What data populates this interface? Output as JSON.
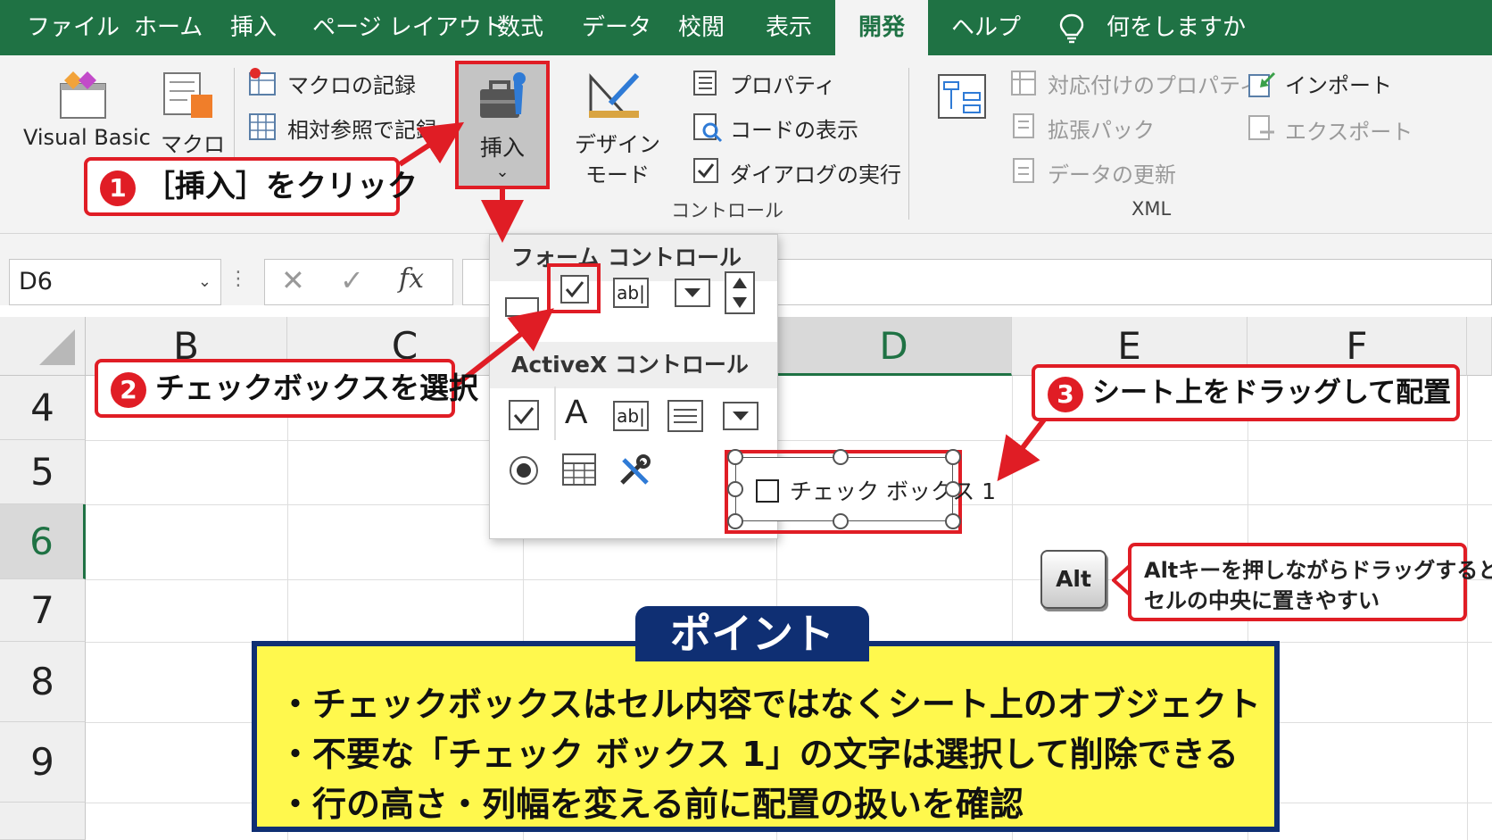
{
  "menu": {
    "tabs": [
      "ファイル",
      "ホーム",
      "挿入",
      "ページ レイアウト",
      "数式",
      "データ",
      "校閲",
      "表示",
      "開発",
      "ヘルプ"
    ],
    "active_tab": "開発",
    "tell_me": "何をしますか"
  },
  "ribbon": {
    "visual_basic": "Visual Basic",
    "macro": "マクロ",
    "record_macro": "マクロの記録",
    "relative_ref": "相対参照で記録",
    "insert": "挿入",
    "design_mode_1": "デザイン",
    "design_mode_2": "モード",
    "properties": "プロパティ",
    "view_code": "コードの表示",
    "run_dialog": "ダイアログの実行",
    "controls_group": "コントロール",
    "map_properties": "対応付けのプロパティ",
    "expansion_pack": "拡張パック",
    "refresh_data": "データの更新",
    "import": "インポート",
    "export": "エクスポート",
    "xml_group": "XML"
  },
  "formula_bar": {
    "name_box": "D6",
    "fx": "fx"
  },
  "grid": {
    "columns": [
      "B",
      "C",
      "D",
      "E",
      "F"
    ],
    "rows": [
      "4",
      "5",
      "6",
      "7",
      "8",
      "9"
    ],
    "selected_column": "D",
    "selected_row": "6"
  },
  "dropdown": {
    "form_controls": "フォーム コントロール",
    "activex_controls": "ActiveX コントロール",
    "text_icon_label": "ab|",
    "label_a": "A"
  },
  "checkbox_control": {
    "label": "チェック ボックス 1"
  },
  "callouts": {
    "step1": {
      "num": "1",
      "text": "［挿入］をクリック"
    },
    "step2": {
      "num": "2",
      "text": "チェックボックスを選択"
    },
    "step3": {
      "num": "3",
      "text": "シート上をドラッグして配置"
    },
    "alt_key": "Alt",
    "alt_line1": "Altキーを押しながらドラッグすると",
    "alt_line2": "セルの中央に置きやすい"
  },
  "point": {
    "title": "ポイント",
    "lines": [
      "・チェックボックスはセル内容ではなくシート上のオブジェクト",
      "・不要な「チェック ボックス 1」の文字は選択して削除できる",
      "・行の高さ・列幅を変える前に配置の扱いを確認"
    ]
  },
  "colors": {
    "excel_green": "#1f7244",
    "callout_red": "#e01d25",
    "point_yellow": "#fff84d",
    "point_navy": "#0f2f73"
  }
}
